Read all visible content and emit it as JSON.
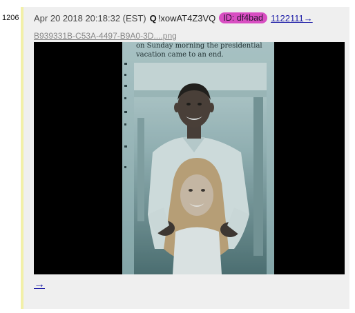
{
  "post": {
    "number": "1206",
    "date": "Apr 20 2018 20:18:32 (EST)",
    "q_marker": "Q",
    "tripcode": "!xowAT4Z3VQ",
    "id_badge": "ID: df4bad",
    "reply_link": "1122111→",
    "filename": "B939331B-C53A-4497-B9A0-3D....png",
    "next_link": "→"
  },
  "image": {
    "clipping_text_line1": "on Sunday morning the presidential",
    "clipping_text_line2": "vacation came to an end."
  },
  "colors": {
    "card_background": "#efefef",
    "card_accent_border": "#f2f0a8",
    "id_badge": "#d84ec2",
    "link": "#1a1aa6"
  }
}
